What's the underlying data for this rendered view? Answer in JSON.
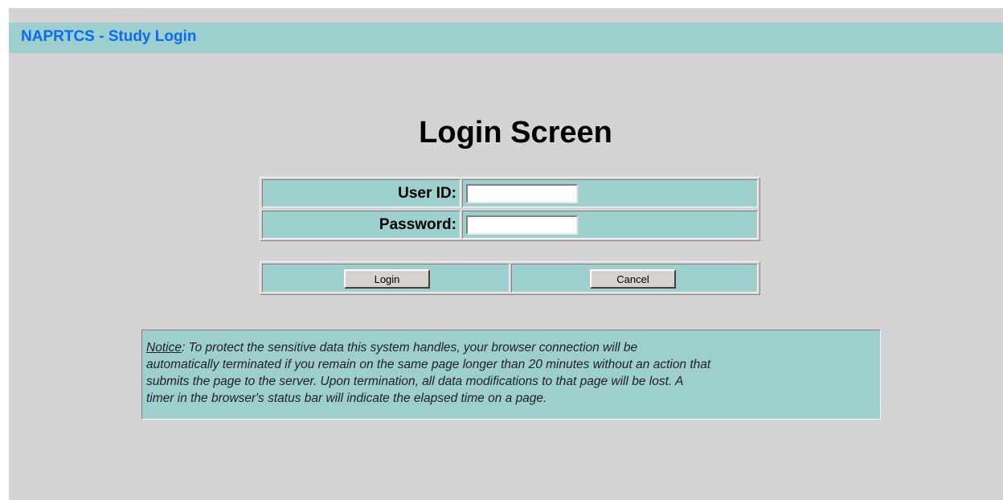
{
  "header": {
    "title": "NAPRTCS - Study Login"
  },
  "main": {
    "heading": "Login Screen",
    "user_id": {
      "label": "User ID:",
      "value": "",
      "placeholder": ""
    },
    "password": {
      "label": "Password:",
      "value": "",
      "placeholder": ""
    },
    "login_label": "Login",
    "cancel_label": "Cancel"
  },
  "notice": {
    "label": "Notice",
    "lines": [
      ": To protect the sensitive data this system handles, your browser connection will be",
      "automatically terminated if you remain on the same page longer than 20 minutes without an action that",
      "submits the page to the server. Upon termination, all data modifications to that page will be lost. A",
      "timer in the browser's status bar will indicate the elapsed time on a page."
    ]
  },
  "colors": {
    "page_bg": "#d6d3d6",
    "panel_bg": "#9ccfce",
    "title_text": "#0a6bf5"
  }
}
